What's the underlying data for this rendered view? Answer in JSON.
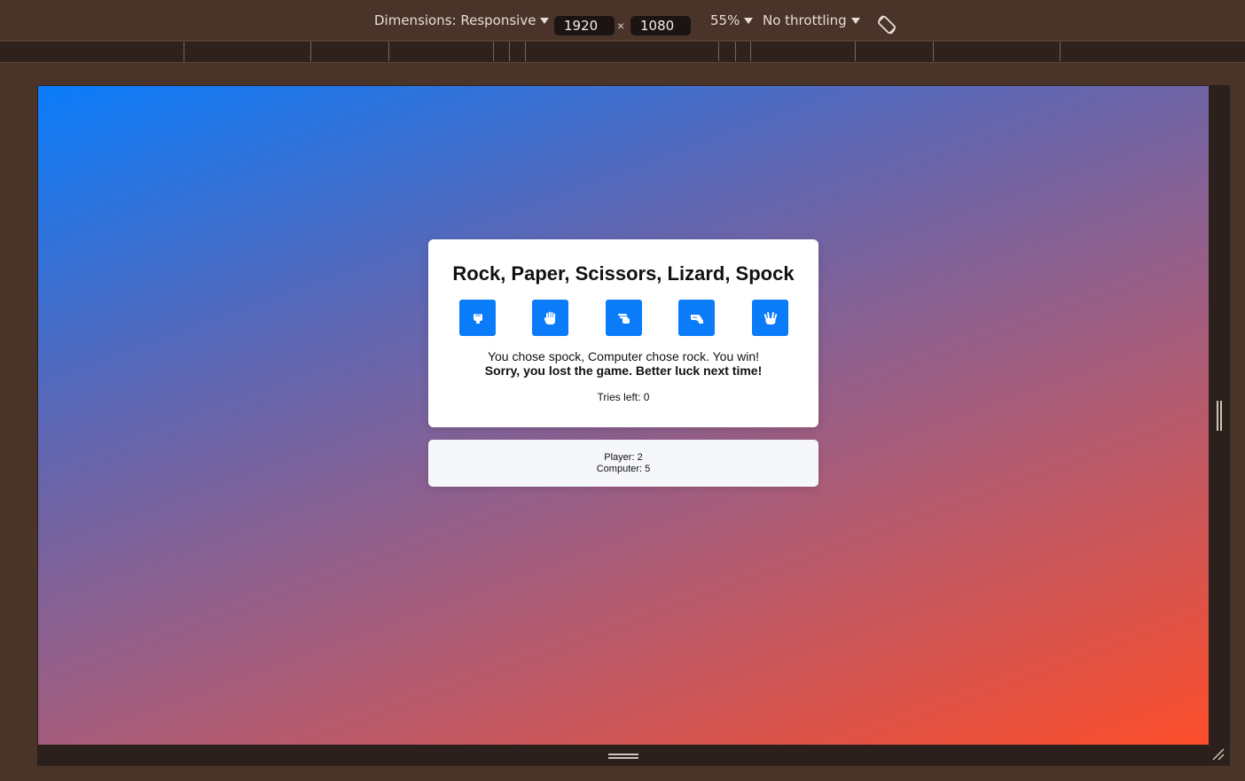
{
  "toolbar": {
    "dimensions_label": "Dimensions: Responsive",
    "width_value": "1920",
    "times_symbol": "×",
    "height_value": "1080",
    "zoom_label": "55%",
    "throttling_label": "No throttling",
    "rotate_icon": "rotate-icon"
  },
  "game": {
    "title": "Rock, Paper, Scissors, Lizard, Spock",
    "choices": [
      {
        "name": "rock",
        "icon": "hand-rock-icon"
      },
      {
        "name": "paper",
        "icon": "hand-paper-icon"
      },
      {
        "name": "scissors",
        "icon": "hand-scissors-icon"
      },
      {
        "name": "lizard",
        "icon": "hand-lizard-icon"
      },
      {
        "name": "spock",
        "icon": "hand-spock-icon"
      }
    ],
    "result_message": "You chose spock, Computer chose rock. You win!",
    "final_message": "Sorry, you lost the game. Better luck next time!",
    "tries_left": "Tries left: 0"
  },
  "score": {
    "player": "Player: 2",
    "computer": "Computer: 5"
  },
  "colors": {
    "devtools_bg": "#4a3328",
    "button_blue": "#0a7cfa",
    "gradient_start": "#0a7cfa",
    "gradient_end": "#fd4e2b"
  }
}
